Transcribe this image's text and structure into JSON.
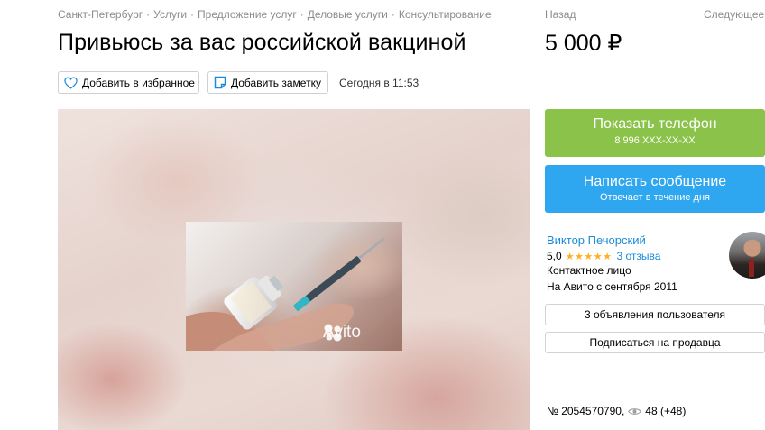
{
  "breadcrumb": {
    "items": [
      "Санкт-Петербург",
      "Услуги",
      "Предложение услуг",
      "Деловые услуги",
      "Консультирование"
    ],
    "separator": "·"
  },
  "nav": {
    "back": "Назад",
    "next": "Следующее"
  },
  "listing": {
    "title": "Привьюсь за вас российской вакциной",
    "price": "5 000 ₽",
    "posted": "Сегодня в 11:53",
    "number": "№ 2054570790,",
    "views": "48 (+48)"
  },
  "actions": {
    "favorite_label": "Добавить в избранное",
    "note_label": "Добавить заметку"
  },
  "gallery": {
    "watermark": "Avito"
  },
  "contact_buttons": {
    "phone_label": "Показать телефон",
    "phone_number": "8 996 XXX-XX-XX",
    "message_label": "Написать сообщение",
    "message_sub": "Отвечает в течение дня"
  },
  "seller": {
    "name": "Виктор Печорский",
    "rating": "5,0",
    "stars": "★★★★★",
    "reviews": "3 отзыва",
    "role": "Контактное лицо",
    "since": "На Авито с сентября 2011",
    "ads_button": "3 объявления пользователя",
    "subscribe_button": "Подписаться на продавца"
  },
  "colors": {
    "green": "#8bc34a",
    "blue": "#2ea7f0",
    "link": "#1a8ad9",
    "star": "#ffb021"
  },
  "icons": [
    "heart-icon",
    "note-icon",
    "eye-icon",
    "avito-dots-icon"
  ]
}
